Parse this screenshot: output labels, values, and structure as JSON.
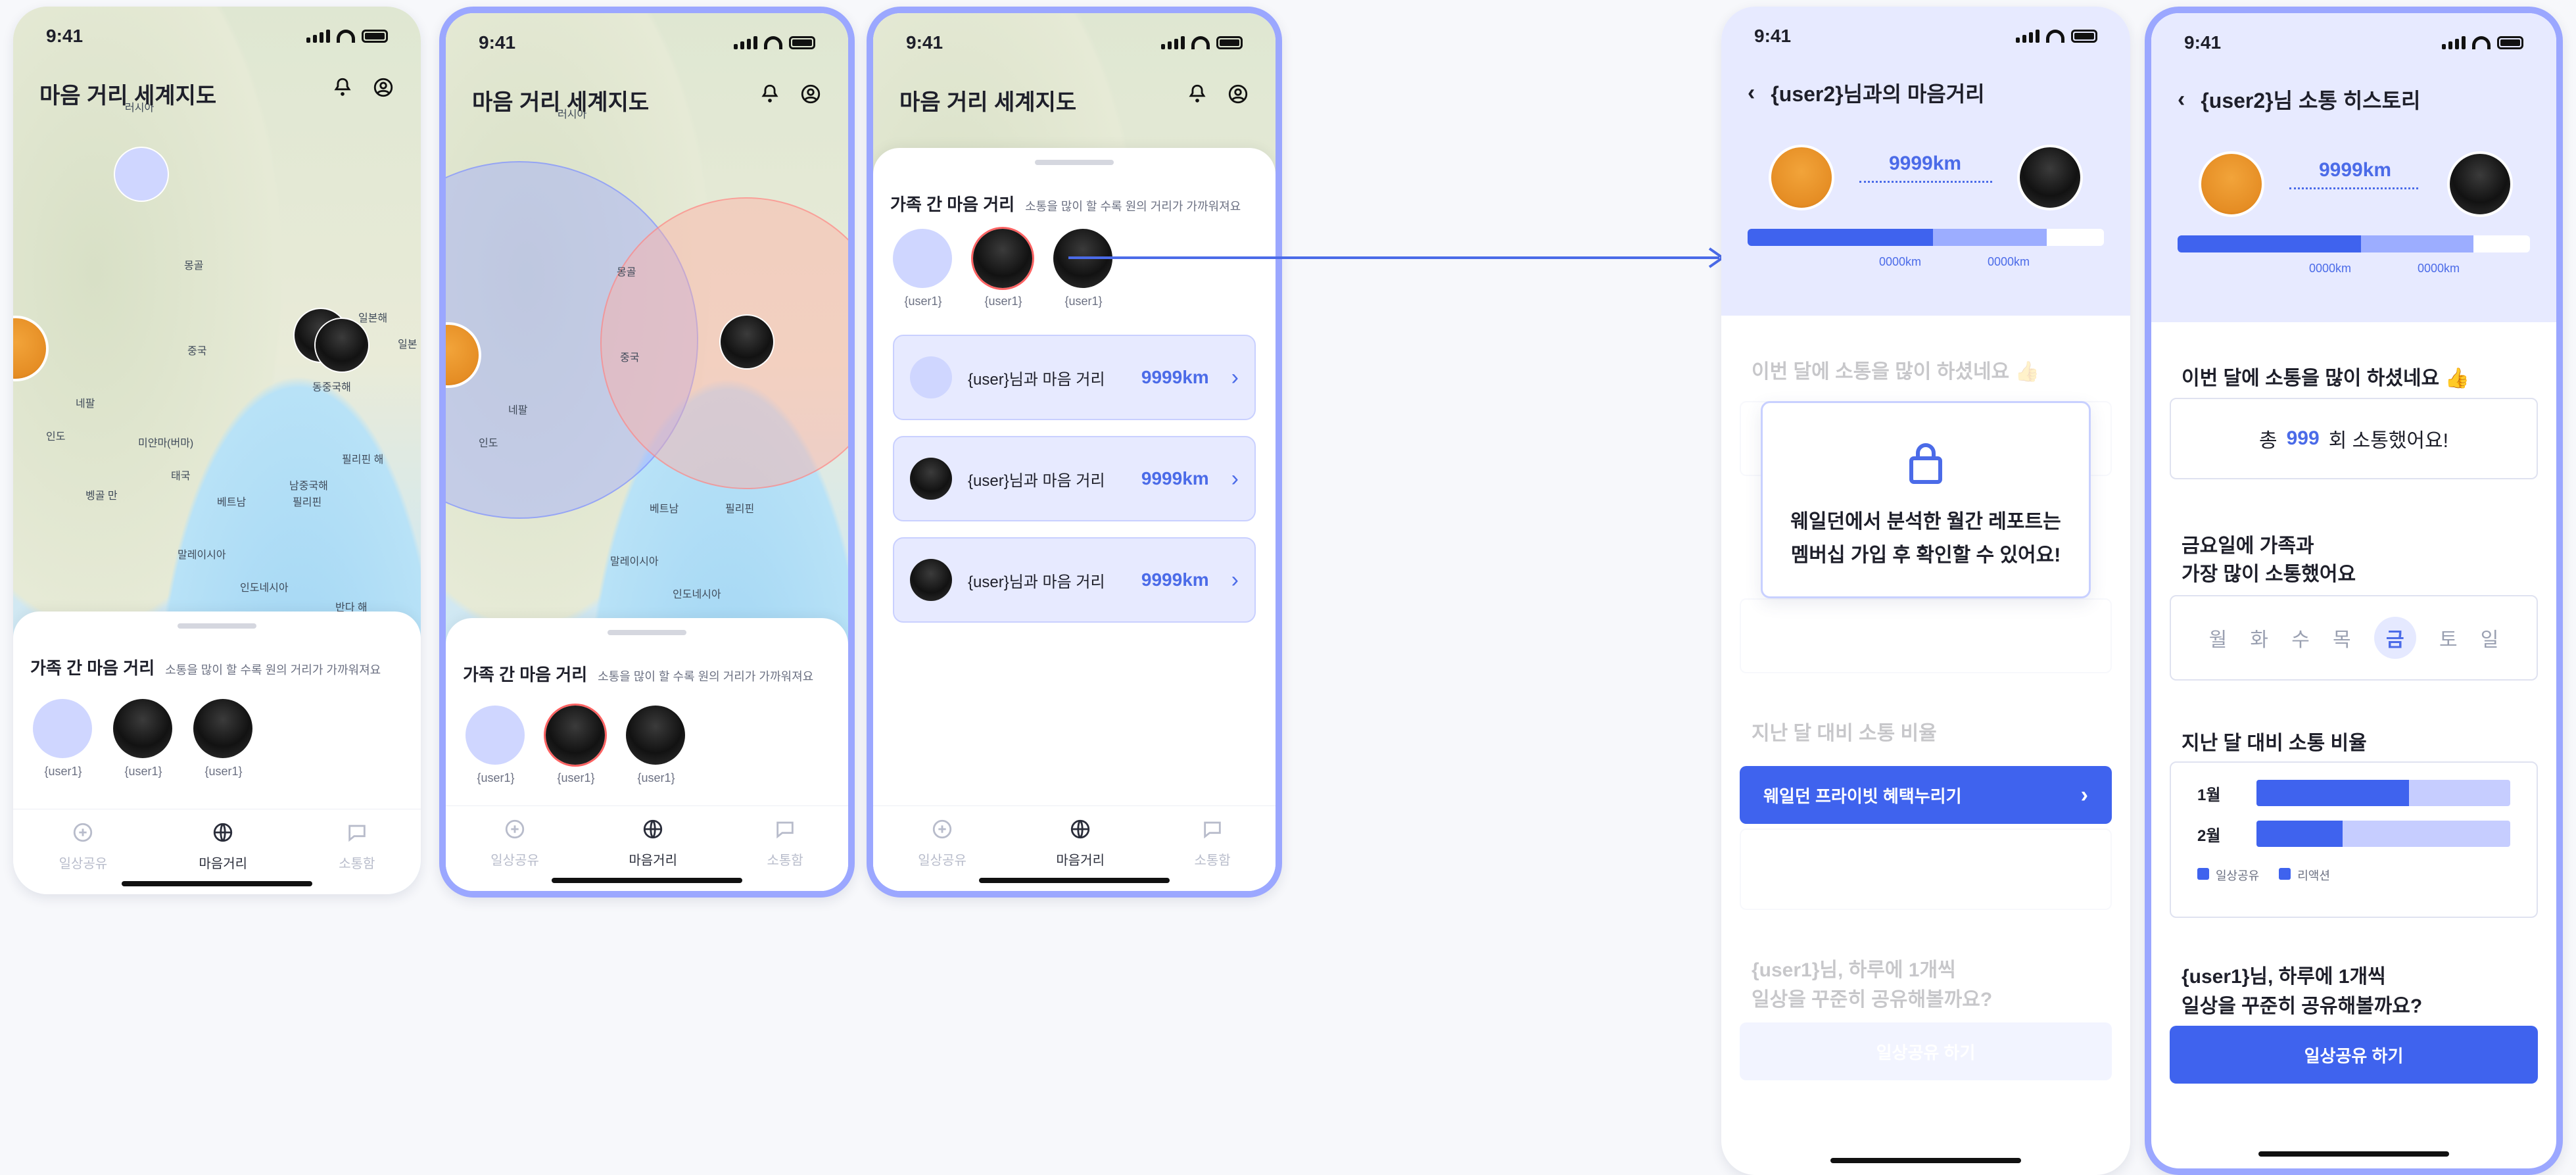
{
  "status": {
    "time": "9:41"
  },
  "map": {
    "title": "마음 거리 세계지도",
    "labels": [
      "러시아",
      "몽골",
      "중국",
      "네팔",
      "인도",
      "미얀마(버마)",
      "태국",
      "벵골 만",
      "남중국해",
      "필리핀 해",
      "베트남",
      "필리핀",
      "말레이시아",
      "인도네시아",
      "반다 해",
      "일본해",
      "일본",
      "동중국해"
    ]
  },
  "family_sheet": {
    "title": "가족 간 마음 거리",
    "subtitle": "소통을 많이 할 수록 원의 거리가 가까워져요",
    "members": [
      "{user1}",
      "{user1}",
      "{user1}"
    ]
  },
  "list_screen": {
    "items": [
      {
        "text": "{user}님과 마음 거리",
        "km": "9999km"
      },
      {
        "text": "{user}님과 마음 거리",
        "km": "9999km"
      },
      {
        "text": "{user}님과 마음 거리",
        "km": "9999km"
      }
    ]
  },
  "tabs": [
    {
      "label": "일상공유"
    },
    {
      "label": "마음거리"
    },
    {
      "label": "소통함"
    }
  ],
  "distance_detail": {
    "title": "{user2}님과의 마음거리",
    "distance": "9999km",
    "left_km": "0000km",
    "right_km": "0000km",
    "progress": {
      "primary": 0.52,
      "secondary": 0.84
    },
    "locked_message": "웨일던에서 분석한 월간 레포트는\n멤버십 가입 후 확인할 수 있어요!",
    "cta": "웨일던 프라이빗 혜택누리기",
    "faded_texts": [
      "이번 달에 소통을 많이 하셨네요 👍",
      "지난 달 대비 소통 비율",
      "{user1}님, 하루에 1개씩",
      "일상을 꾸준히 공유해볼까요?",
      "일상공유 하기"
    ]
  },
  "history": {
    "title": "{user2}님 소통 히스토리",
    "distance": "9999km",
    "left_km": "0000km",
    "right_km": "0000km",
    "progress": {
      "primary": 0.52,
      "secondary": 0.84
    },
    "month_title": "이번 달에 소통을 많이 하셨네요 👍",
    "total_prefix": "총",
    "total_count": "999",
    "total_suffix": "회 소통했어요!",
    "day_title_1": "금요일에 가족과",
    "day_title_2": "가장 많이 소통했어요",
    "days": [
      "월",
      "화",
      "수",
      "목",
      "금",
      "토",
      "일"
    ],
    "selected_day": "금",
    "ratio_title": "지난 달 대비 소통 비율",
    "bars": [
      {
        "label": "1월",
        "value": 0.6
      },
      {
        "label": "2월",
        "value": 0.34
      }
    ],
    "legend": [
      "일상공유",
      "리액션"
    ],
    "suggest_1": "{user1}님, 하루에 1개씩",
    "suggest_2": "일상을 꾸준히 공유해볼까요?",
    "cta": "일상공유 하기"
  },
  "colors": {
    "accent": "#3f63ee",
    "lavender": "#e7eaff",
    "outline": "#9ba7ff"
  }
}
